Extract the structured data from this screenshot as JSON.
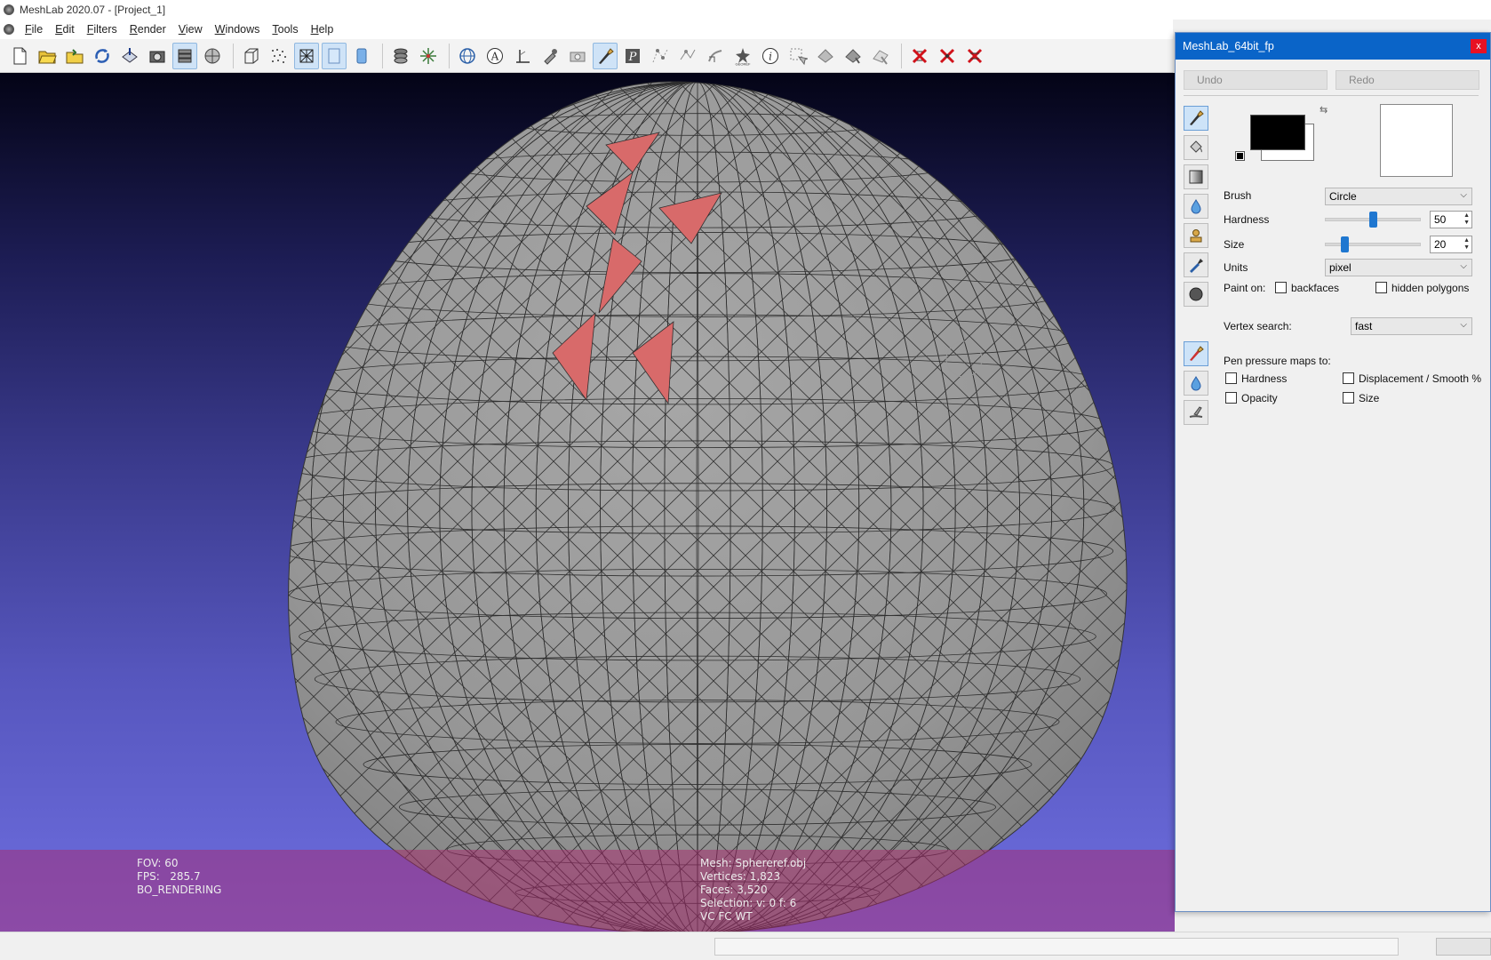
{
  "window": {
    "title": "MeshLab 2020.07 - [Project_1]"
  },
  "menu": {
    "items": [
      "File",
      "Edit",
      "Filters",
      "Render",
      "View",
      "Windows",
      "Tools",
      "Help"
    ]
  },
  "toolbar": {
    "icons": [
      "new-project-icon",
      "open-project-icon",
      "import-mesh-icon",
      "reload-icon",
      "export-icon",
      "snapshot-icon",
      "layers-icon",
      "render-mode-icon",
      "bbox-icon",
      "points-icon",
      "wireframe-icon",
      "flat-icon",
      "smooth-icon",
      "layer-stack-icon",
      "trackball-icon",
      "globe-icon",
      "annotate-icon",
      "measure-icon",
      "paint-select-icon",
      "camera-icon",
      "z-paint-icon",
      "texture-icon",
      "select-vertex-icon",
      "select-connected-icon",
      "align-icon",
      "georef-icon",
      "info-icon",
      "select-faces-icon",
      "select-region-icon",
      "select-z-icon",
      "select-stroke-icon",
      "delete-faces-icon",
      "delete-vertices-icon",
      "delete-all-icon"
    ]
  },
  "viewport": {
    "info_left": [
      "FOV: 60",
      "FPS:   285.7",
      "BO_RENDERING"
    ],
    "info_mid": [
      "Mesh: Sphereref.obj",
      "Vertices: 1,823",
      "Faces: 3,520",
      "Selection: v: 0 f: 6",
      "VC FC WT"
    ]
  },
  "panel": {
    "title": "MeshLab_64bit_fp",
    "close": "x",
    "undo_label": "Undo",
    "redo_label": "Redo",
    "brush_label": "Brush",
    "brush_value": "Circle",
    "hardness_label": "Hardness",
    "hardness_value": "50",
    "hardness_level": 0.5,
    "size_label": "Size",
    "size_value": "20",
    "size_level": 0.2,
    "units_label": "Units",
    "units_value": "pixel",
    "paint_on_label": "Paint on:",
    "backfaces_label": "backfaces",
    "hidden_polygons_label": "hidden polygons",
    "vertex_search_label": "Vertex search:",
    "vertex_search_value": "fast",
    "pen_pressure_label": "Pen pressure maps to:",
    "pp_hardness_label": "Hardness",
    "pp_displacement_label": "Displacement / Smooth %",
    "pp_opacity_label": "Opacity",
    "pp_size_label": "Size",
    "colors": {
      "foreground": "#000000",
      "background": "#ffffff",
      "accent": "#0a64c8"
    }
  }
}
